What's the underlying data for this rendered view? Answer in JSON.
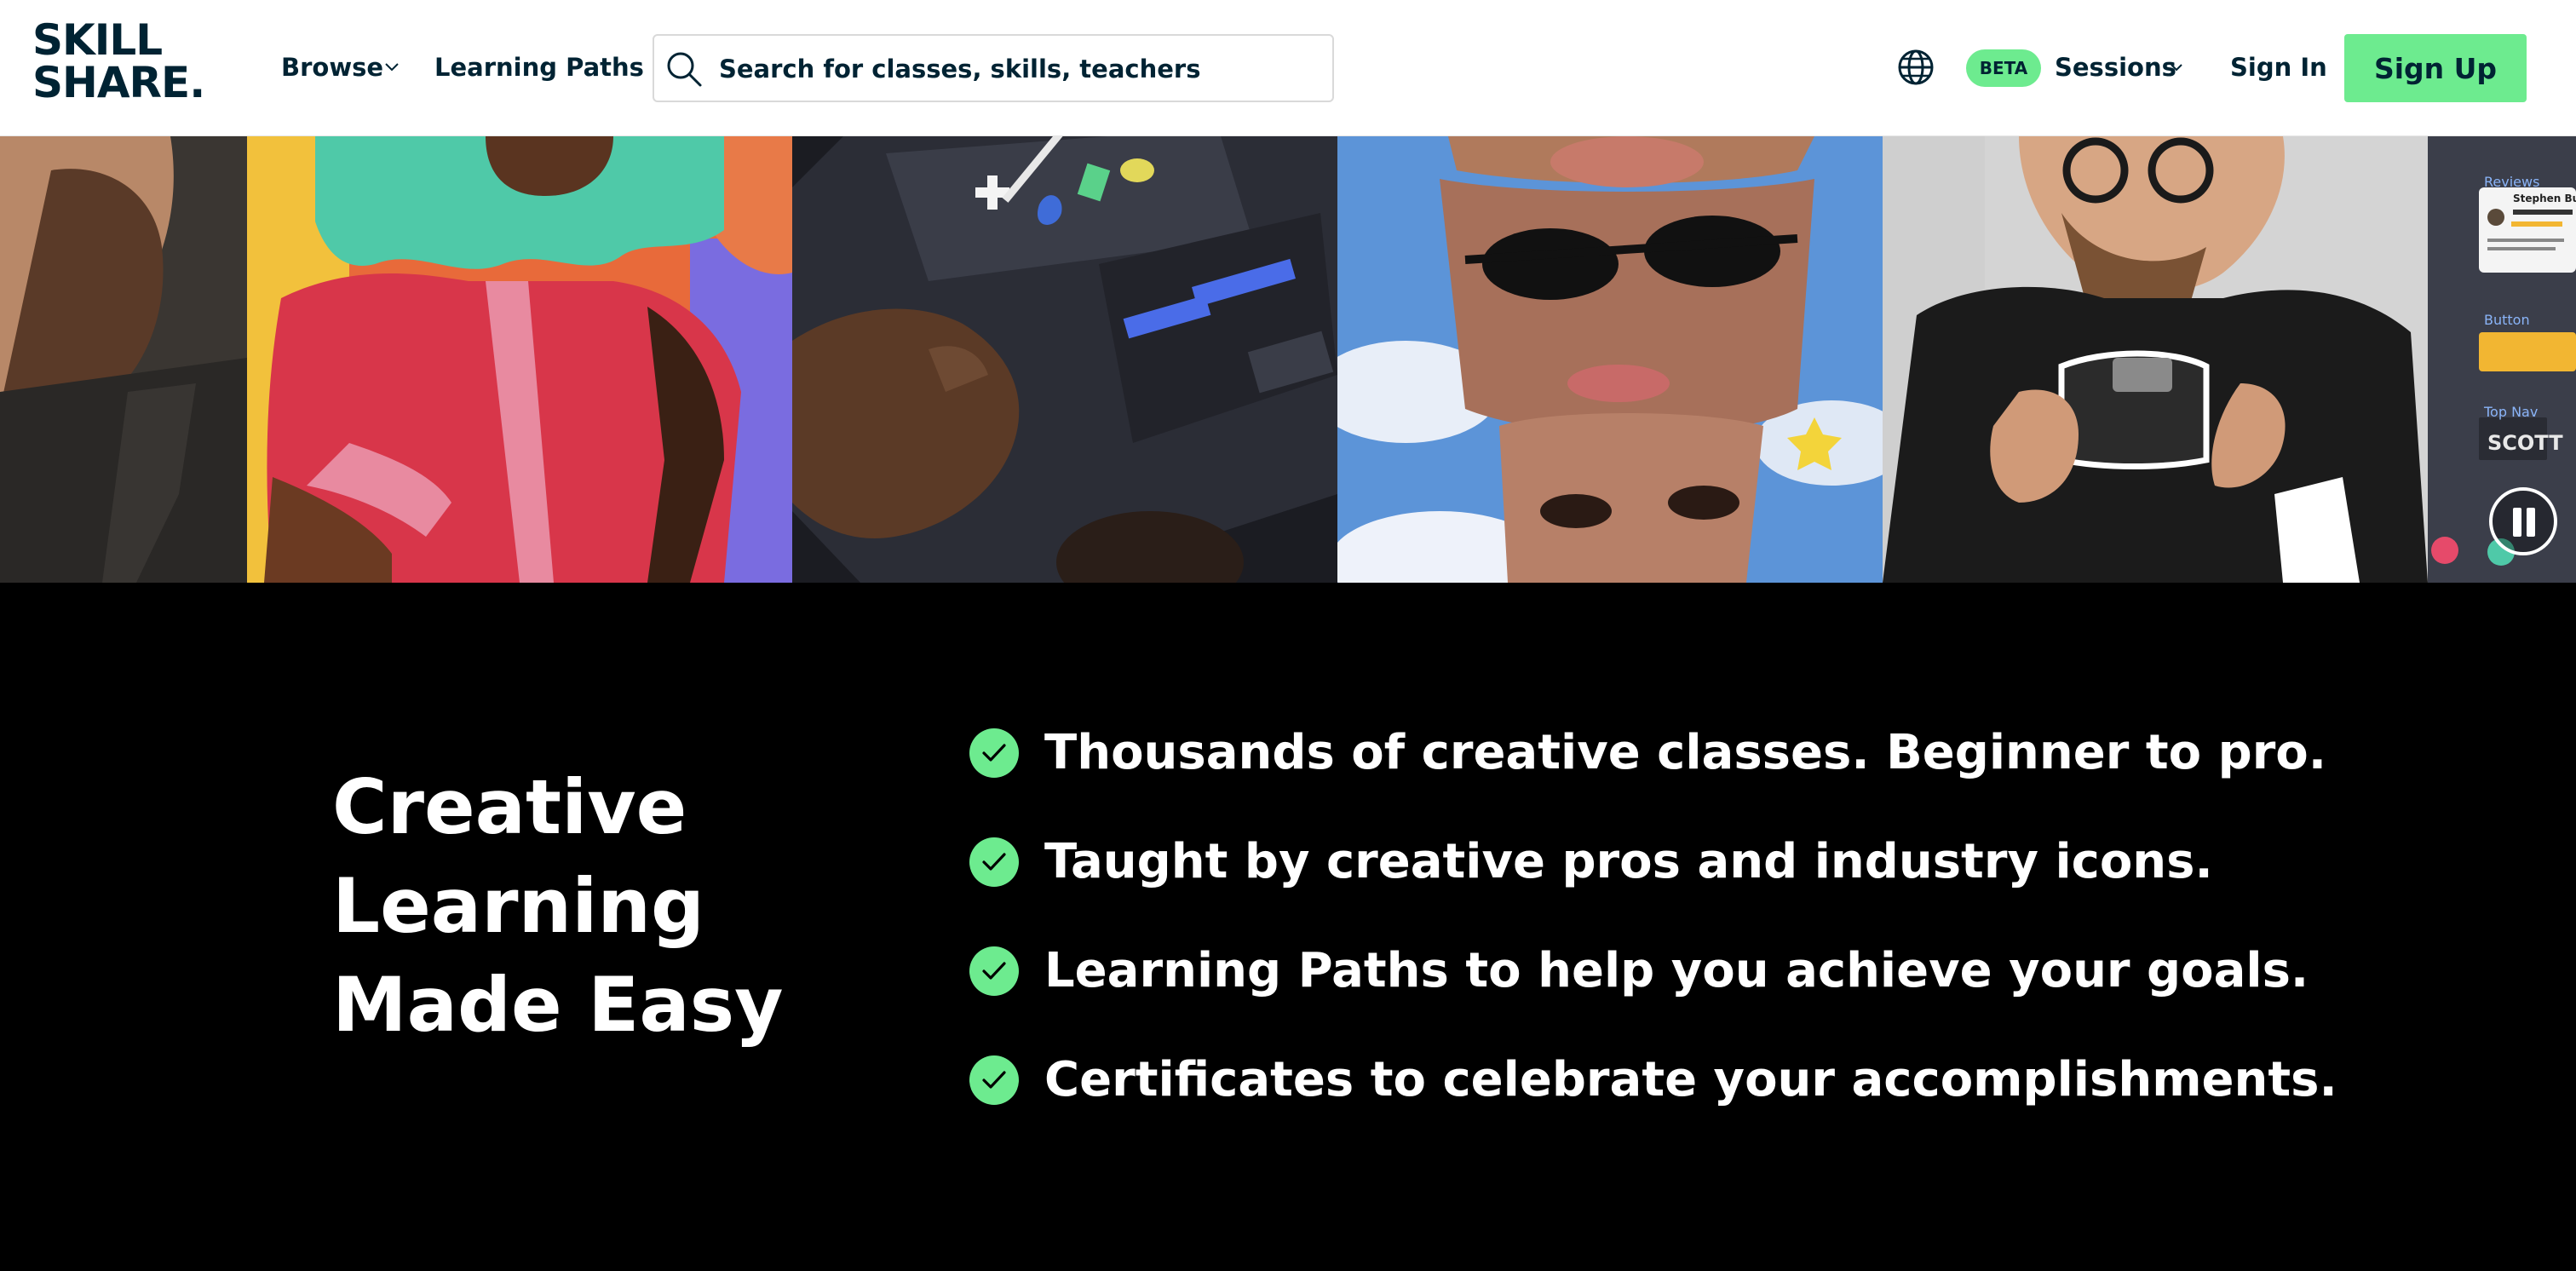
{
  "brand": {
    "line1": "SKILL",
    "line2": "SHARE."
  },
  "nav": {
    "browse": "Browse",
    "learning_paths": "Learning Paths",
    "search_placeholder": "Search for classes, skills, teachers",
    "beta": "BETA",
    "sessions": "Sessions",
    "sign_in": "Sign In",
    "sign_up": "Sign Up"
  },
  "hero": {
    "overlay_texts": {
      "reviews": "Reviews",
      "reviewer": "Stephen Butler",
      "button": "Button",
      "top_nav": "Top Nav",
      "scott": "SCOTT"
    }
  },
  "main": {
    "headline_lines": [
      "Creative",
      "Learning",
      "Made Easy"
    ],
    "features": [
      "Thousands of creative classes. Beginner to pro.",
      "Taught by creative pros and industry icons.",
      "Learning Paths to help you achieve your goals.",
      "Certificates to celebrate your accomplishments."
    ]
  },
  "colors": {
    "accent": "#6deb8f",
    "dark_text": "#002333",
    "background": "#000000"
  }
}
